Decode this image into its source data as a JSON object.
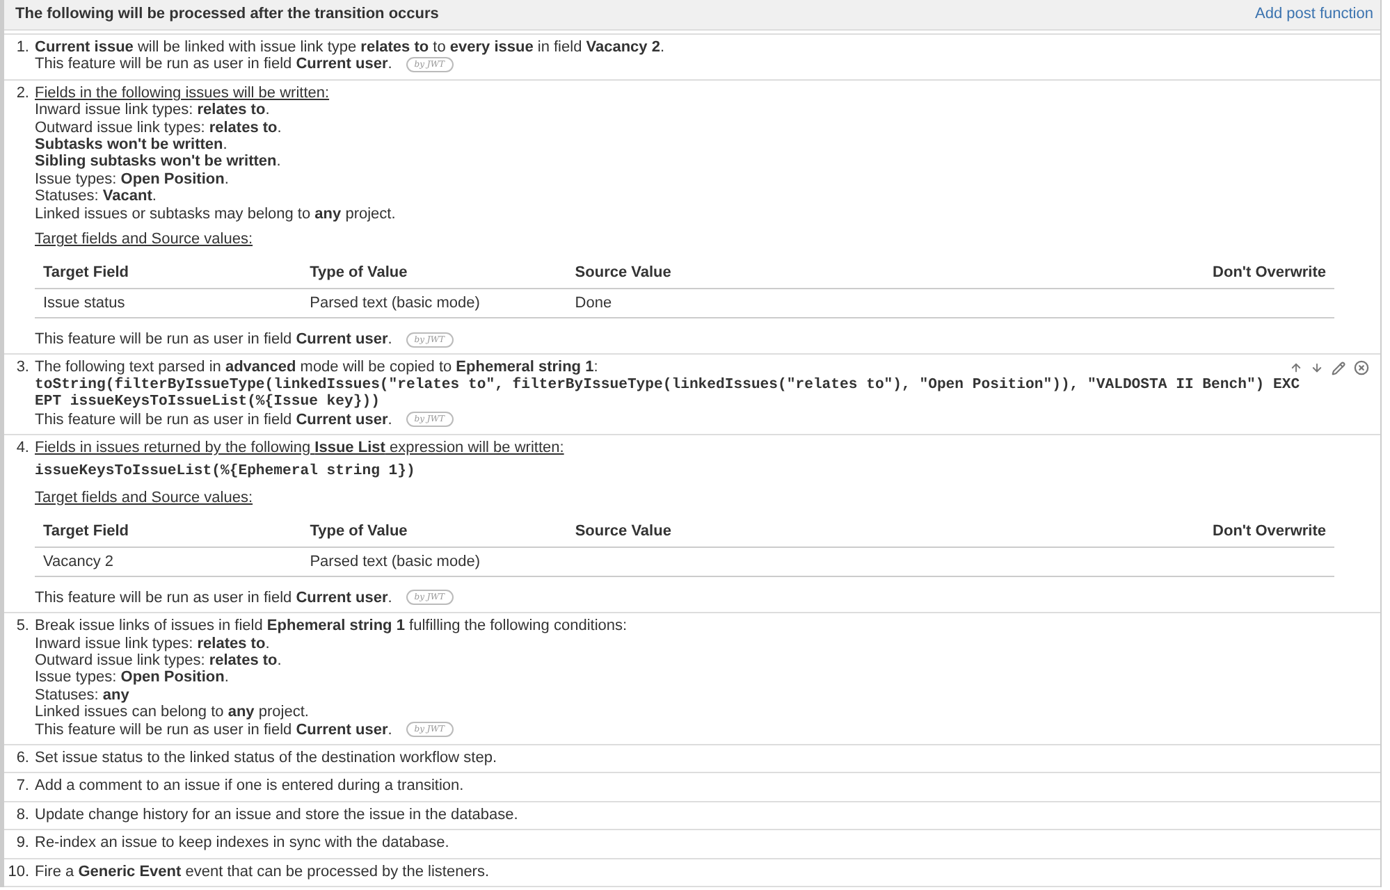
{
  "header": {
    "title": "The following will be processed after the transition occurs",
    "action": "Add post function"
  },
  "items": [
    {
      "number": "1.",
      "hovered": false,
      "blocks": [
        {
          "kind": "text",
          "text": "**Current issue** will be linked with issue link type **relates to** to **every issue** in field **Vacancy 2**."
        },
        {
          "kind": "run_as",
          "text": "This feature will be run as user in field **Current user**.",
          "badge": "by JWT"
        }
      ]
    },
    {
      "number": "2.",
      "hovered": false,
      "blocks": [
        {
          "kind": "heading",
          "text": "Fields in the following issues will be written:"
        },
        {
          "kind": "text",
          "text": "Inward issue link types: **relates to**."
        },
        {
          "kind": "text",
          "text": "Outward issue link types: **relates to**."
        },
        {
          "kind": "text",
          "text": "**Subtasks won't be written**."
        },
        {
          "kind": "text",
          "text": "**Sibling subtasks won't be written**."
        },
        {
          "kind": "text",
          "text": "Issue types: **Open Position**."
        },
        {
          "kind": "text",
          "text": "Statuses: **Vacant**."
        },
        {
          "kind": "text",
          "text": "Linked issues or subtasks may belong to **any** project."
        },
        {
          "kind": "subheading",
          "text": "Target fields and Source values:"
        },
        {
          "kind": "table",
          "columns": [
            "Target Field",
            "Type of Value",
            "Source Value",
            "Don't Overwrite"
          ],
          "rows": [
            [
              "Issue status",
              "Parsed text (basic mode)",
              "Done",
              ""
            ]
          ]
        },
        {
          "kind": "run_as_gap",
          "text": "This feature will be run as user in field **Current user**.",
          "badge": "by JWT"
        }
      ]
    },
    {
      "number": "3.",
      "hovered": true,
      "blocks": [
        {
          "kind": "text",
          "text": "The following text parsed in **advanced** mode will be copied to **Ephemeral string 1**:"
        },
        {
          "kind": "code",
          "text": "toString(filterByIssueType(linkedIssues(\"relates to\", filterByIssueType(linkedIssues(\"relates to\"), \"Open Position\")), \"VALDOSTA II Bench\") EXCEPT issueKeysToIssueList(%{Issue key}))"
        },
        {
          "kind": "run_as",
          "text": "This feature will be run as user in field **Current user**.",
          "badge": "by JWT"
        }
      ]
    },
    {
      "number": "4.",
      "hovered": false,
      "blocks": [
        {
          "kind": "heading",
          "text": "Fields in issues returned by the following **Issue List** expression will be written:"
        },
        {
          "kind": "code_gap",
          "text": "issueKeysToIssueList(%{Ephemeral string 1})"
        },
        {
          "kind": "subheading",
          "text": "Target fields and Source values:"
        },
        {
          "kind": "table",
          "columns": [
            "Target Field",
            "Type of Value",
            "Source Value",
            "Don't Overwrite"
          ],
          "rows": [
            [
              "Vacancy 2",
              "Parsed text (basic mode)",
              "",
              ""
            ]
          ]
        },
        {
          "kind": "run_as_gap",
          "text": "This feature will be run as user in field **Current user**.",
          "badge": "by JWT"
        }
      ]
    },
    {
      "number": "5.",
      "hovered": false,
      "blocks": [
        {
          "kind": "text",
          "text": "Break issue links of issues in field **Ephemeral string 1** fulfilling the following conditions:"
        },
        {
          "kind": "text",
          "text": "Inward issue link types: **relates to**."
        },
        {
          "kind": "text",
          "text": "Outward issue link types: **relates to**."
        },
        {
          "kind": "text",
          "text": "Issue types: **Open Position**."
        },
        {
          "kind": "text",
          "text": "Statuses: **any**"
        },
        {
          "kind": "text",
          "text": "Linked issues can belong to **any** project."
        },
        {
          "kind": "run_as",
          "text": "This feature will be run as user in field **Current user**.",
          "badge": "by JWT"
        }
      ]
    },
    {
      "number": "6.",
      "hovered": false,
      "blocks": [
        {
          "kind": "text",
          "text": "Set issue status to the linked status of the destination workflow step."
        }
      ]
    },
    {
      "number": "7.",
      "hovered": false,
      "blocks": [
        {
          "kind": "text",
          "text": "Add a comment to an issue if one is entered during a transition."
        }
      ]
    },
    {
      "number": "8.",
      "hovered": false,
      "blocks": [
        {
          "kind": "text",
          "text": "Update change history for an issue and store the issue in the database."
        }
      ]
    },
    {
      "number": "9.",
      "hovered": false,
      "blocks": [
        {
          "kind": "text",
          "text": "Re-index an issue to keep indexes in sync with the database."
        }
      ]
    },
    {
      "number": "10.",
      "hovered": false,
      "blocks": [
        {
          "kind": "text",
          "text": "Fire a **Generic Event** event that can be processed by the listeners."
        }
      ]
    }
  ]
}
